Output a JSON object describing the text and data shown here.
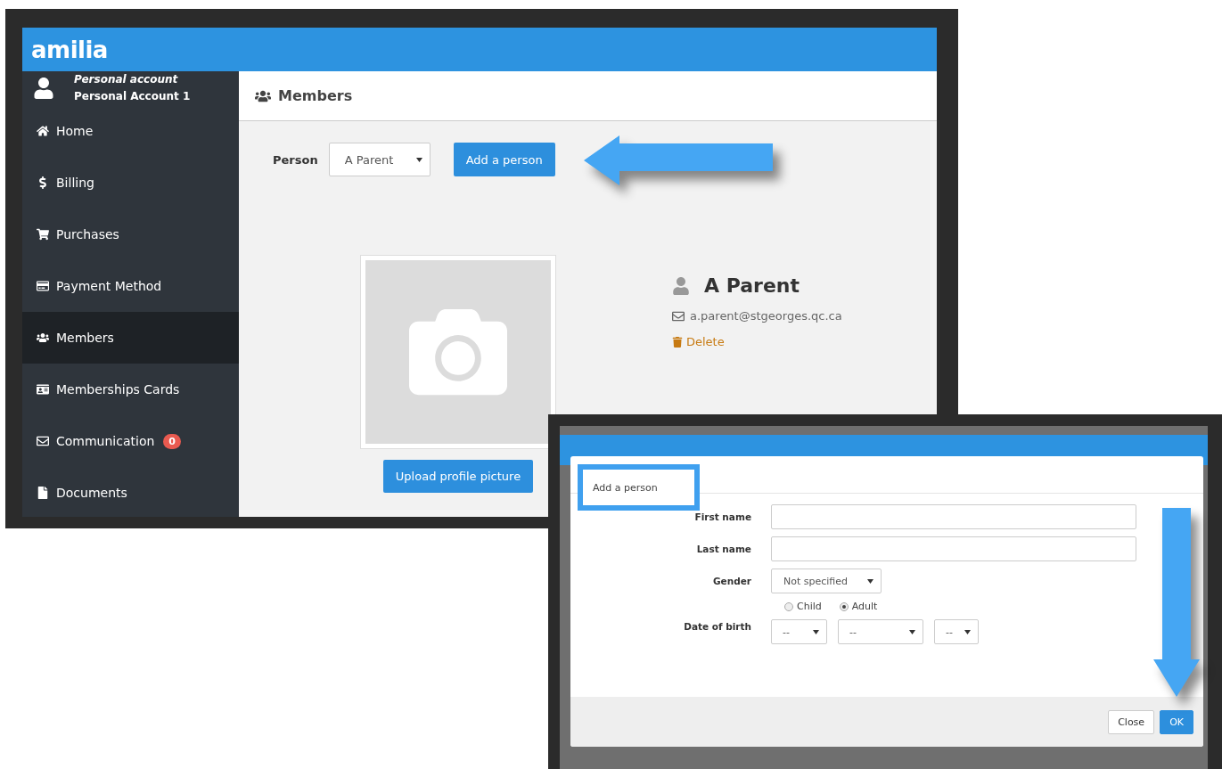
{
  "logo": "amilia",
  "account": {
    "type": "Personal account",
    "name": "Personal Account 1"
  },
  "sidebar": {
    "items": [
      {
        "label": "Home",
        "selected": false
      },
      {
        "label": "Billing",
        "selected": false
      },
      {
        "label": "Purchases",
        "selected": false
      },
      {
        "label": "Payment Method",
        "selected": false
      },
      {
        "label": "Members",
        "selected": true
      },
      {
        "label": "Memberships Cards",
        "selected": false
      },
      {
        "label": "Communication",
        "selected": false,
        "badge": "0"
      },
      {
        "label": "Documents",
        "selected": false
      }
    ]
  },
  "page": {
    "title": "Members",
    "person_label": "Person",
    "person_select": "A Parent",
    "add_button": "Add a person",
    "upload_button": "Upload profile picture",
    "profile": {
      "name": "A Parent",
      "email": "a.parent@stgeorges.qc.ca",
      "delete": "Delete"
    }
  },
  "dialog": {
    "title": "Add a person",
    "fields": [
      {
        "kind": "text",
        "label": "First name"
      },
      {
        "kind": "text",
        "label": "Last name"
      },
      {
        "kind": "select",
        "label": "Gender",
        "value": "Not specified"
      },
      {
        "kind": "radio",
        "options": [
          {
            "label": "Child",
            "selected": false
          },
          {
            "label": "Adult",
            "selected": true
          }
        ]
      },
      {
        "kind": "date",
        "label": "Date of birth",
        "parts": [
          "--",
          "--",
          "--"
        ]
      }
    ],
    "buttons": [
      {
        "label": "Close",
        "kind": "default"
      },
      {
        "label": "OK",
        "kind": "primary"
      }
    ]
  }
}
